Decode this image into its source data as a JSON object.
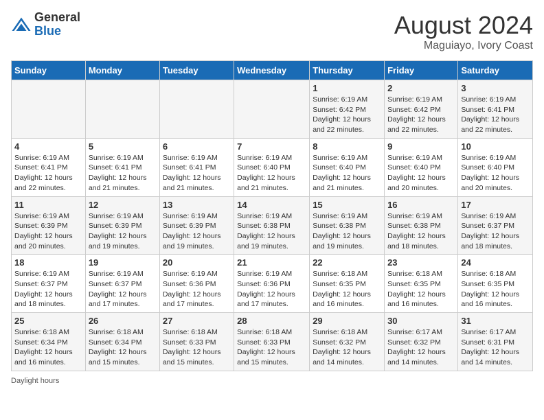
{
  "header": {
    "logo_general": "General",
    "logo_blue": "Blue",
    "title": "August 2024",
    "subtitle": "Maguiayo, Ivory Coast"
  },
  "footer": {
    "label": "Daylight hours"
  },
  "weekdays": [
    "Sunday",
    "Monday",
    "Tuesday",
    "Wednesday",
    "Thursday",
    "Friday",
    "Saturday"
  ],
  "weeks": [
    [
      {
        "date": "",
        "info": ""
      },
      {
        "date": "",
        "info": ""
      },
      {
        "date": "",
        "info": ""
      },
      {
        "date": "",
        "info": ""
      },
      {
        "date": "1",
        "info": "Sunrise: 6:19 AM\nSunset: 6:42 PM\nDaylight: 12 hours and 22 minutes."
      },
      {
        "date": "2",
        "info": "Sunrise: 6:19 AM\nSunset: 6:42 PM\nDaylight: 12 hours and 22 minutes."
      },
      {
        "date": "3",
        "info": "Sunrise: 6:19 AM\nSunset: 6:41 PM\nDaylight: 12 hours and 22 minutes."
      }
    ],
    [
      {
        "date": "4",
        "info": "Sunrise: 6:19 AM\nSunset: 6:41 PM\nDaylight: 12 hours and 22 minutes."
      },
      {
        "date": "5",
        "info": "Sunrise: 6:19 AM\nSunset: 6:41 PM\nDaylight: 12 hours and 21 minutes."
      },
      {
        "date": "6",
        "info": "Sunrise: 6:19 AM\nSunset: 6:41 PM\nDaylight: 12 hours and 21 minutes."
      },
      {
        "date": "7",
        "info": "Sunrise: 6:19 AM\nSunset: 6:40 PM\nDaylight: 12 hours and 21 minutes."
      },
      {
        "date": "8",
        "info": "Sunrise: 6:19 AM\nSunset: 6:40 PM\nDaylight: 12 hours and 21 minutes."
      },
      {
        "date": "9",
        "info": "Sunrise: 6:19 AM\nSunset: 6:40 PM\nDaylight: 12 hours and 20 minutes."
      },
      {
        "date": "10",
        "info": "Sunrise: 6:19 AM\nSunset: 6:40 PM\nDaylight: 12 hours and 20 minutes."
      }
    ],
    [
      {
        "date": "11",
        "info": "Sunrise: 6:19 AM\nSunset: 6:39 PM\nDaylight: 12 hours and 20 minutes."
      },
      {
        "date": "12",
        "info": "Sunrise: 6:19 AM\nSunset: 6:39 PM\nDaylight: 12 hours and 19 minutes."
      },
      {
        "date": "13",
        "info": "Sunrise: 6:19 AM\nSunset: 6:39 PM\nDaylight: 12 hours and 19 minutes."
      },
      {
        "date": "14",
        "info": "Sunrise: 6:19 AM\nSunset: 6:38 PM\nDaylight: 12 hours and 19 minutes."
      },
      {
        "date": "15",
        "info": "Sunrise: 6:19 AM\nSunset: 6:38 PM\nDaylight: 12 hours and 19 minutes."
      },
      {
        "date": "16",
        "info": "Sunrise: 6:19 AM\nSunset: 6:38 PM\nDaylight: 12 hours and 18 minutes."
      },
      {
        "date": "17",
        "info": "Sunrise: 6:19 AM\nSunset: 6:37 PM\nDaylight: 12 hours and 18 minutes."
      }
    ],
    [
      {
        "date": "18",
        "info": "Sunrise: 6:19 AM\nSunset: 6:37 PM\nDaylight: 12 hours and 18 minutes."
      },
      {
        "date": "19",
        "info": "Sunrise: 6:19 AM\nSunset: 6:37 PM\nDaylight: 12 hours and 17 minutes."
      },
      {
        "date": "20",
        "info": "Sunrise: 6:19 AM\nSunset: 6:36 PM\nDaylight: 12 hours and 17 minutes."
      },
      {
        "date": "21",
        "info": "Sunrise: 6:19 AM\nSunset: 6:36 PM\nDaylight: 12 hours and 17 minutes."
      },
      {
        "date": "22",
        "info": "Sunrise: 6:18 AM\nSunset: 6:35 PM\nDaylight: 12 hours and 16 minutes."
      },
      {
        "date": "23",
        "info": "Sunrise: 6:18 AM\nSunset: 6:35 PM\nDaylight: 12 hours and 16 minutes."
      },
      {
        "date": "24",
        "info": "Sunrise: 6:18 AM\nSunset: 6:35 PM\nDaylight: 12 hours and 16 minutes."
      }
    ],
    [
      {
        "date": "25",
        "info": "Sunrise: 6:18 AM\nSunset: 6:34 PM\nDaylight: 12 hours and 16 minutes."
      },
      {
        "date": "26",
        "info": "Sunrise: 6:18 AM\nSunset: 6:34 PM\nDaylight: 12 hours and 15 minutes."
      },
      {
        "date": "27",
        "info": "Sunrise: 6:18 AM\nSunset: 6:33 PM\nDaylight: 12 hours and 15 minutes."
      },
      {
        "date": "28",
        "info": "Sunrise: 6:18 AM\nSunset: 6:33 PM\nDaylight: 12 hours and 15 minutes."
      },
      {
        "date": "29",
        "info": "Sunrise: 6:18 AM\nSunset: 6:32 PM\nDaylight: 12 hours and 14 minutes."
      },
      {
        "date": "30",
        "info": "Sunrise: 6:17 AM\nSunset: 6:32 PM\nDaylight: 12 hours and 14 minutes."
      },
      {
        "date": "31",
        "info": "Sunrise: 6:17 AM\nSunset: 6:31 PM\nDaylight: 12 hours and 14 minutes."
      }
    ]
  ]
}
